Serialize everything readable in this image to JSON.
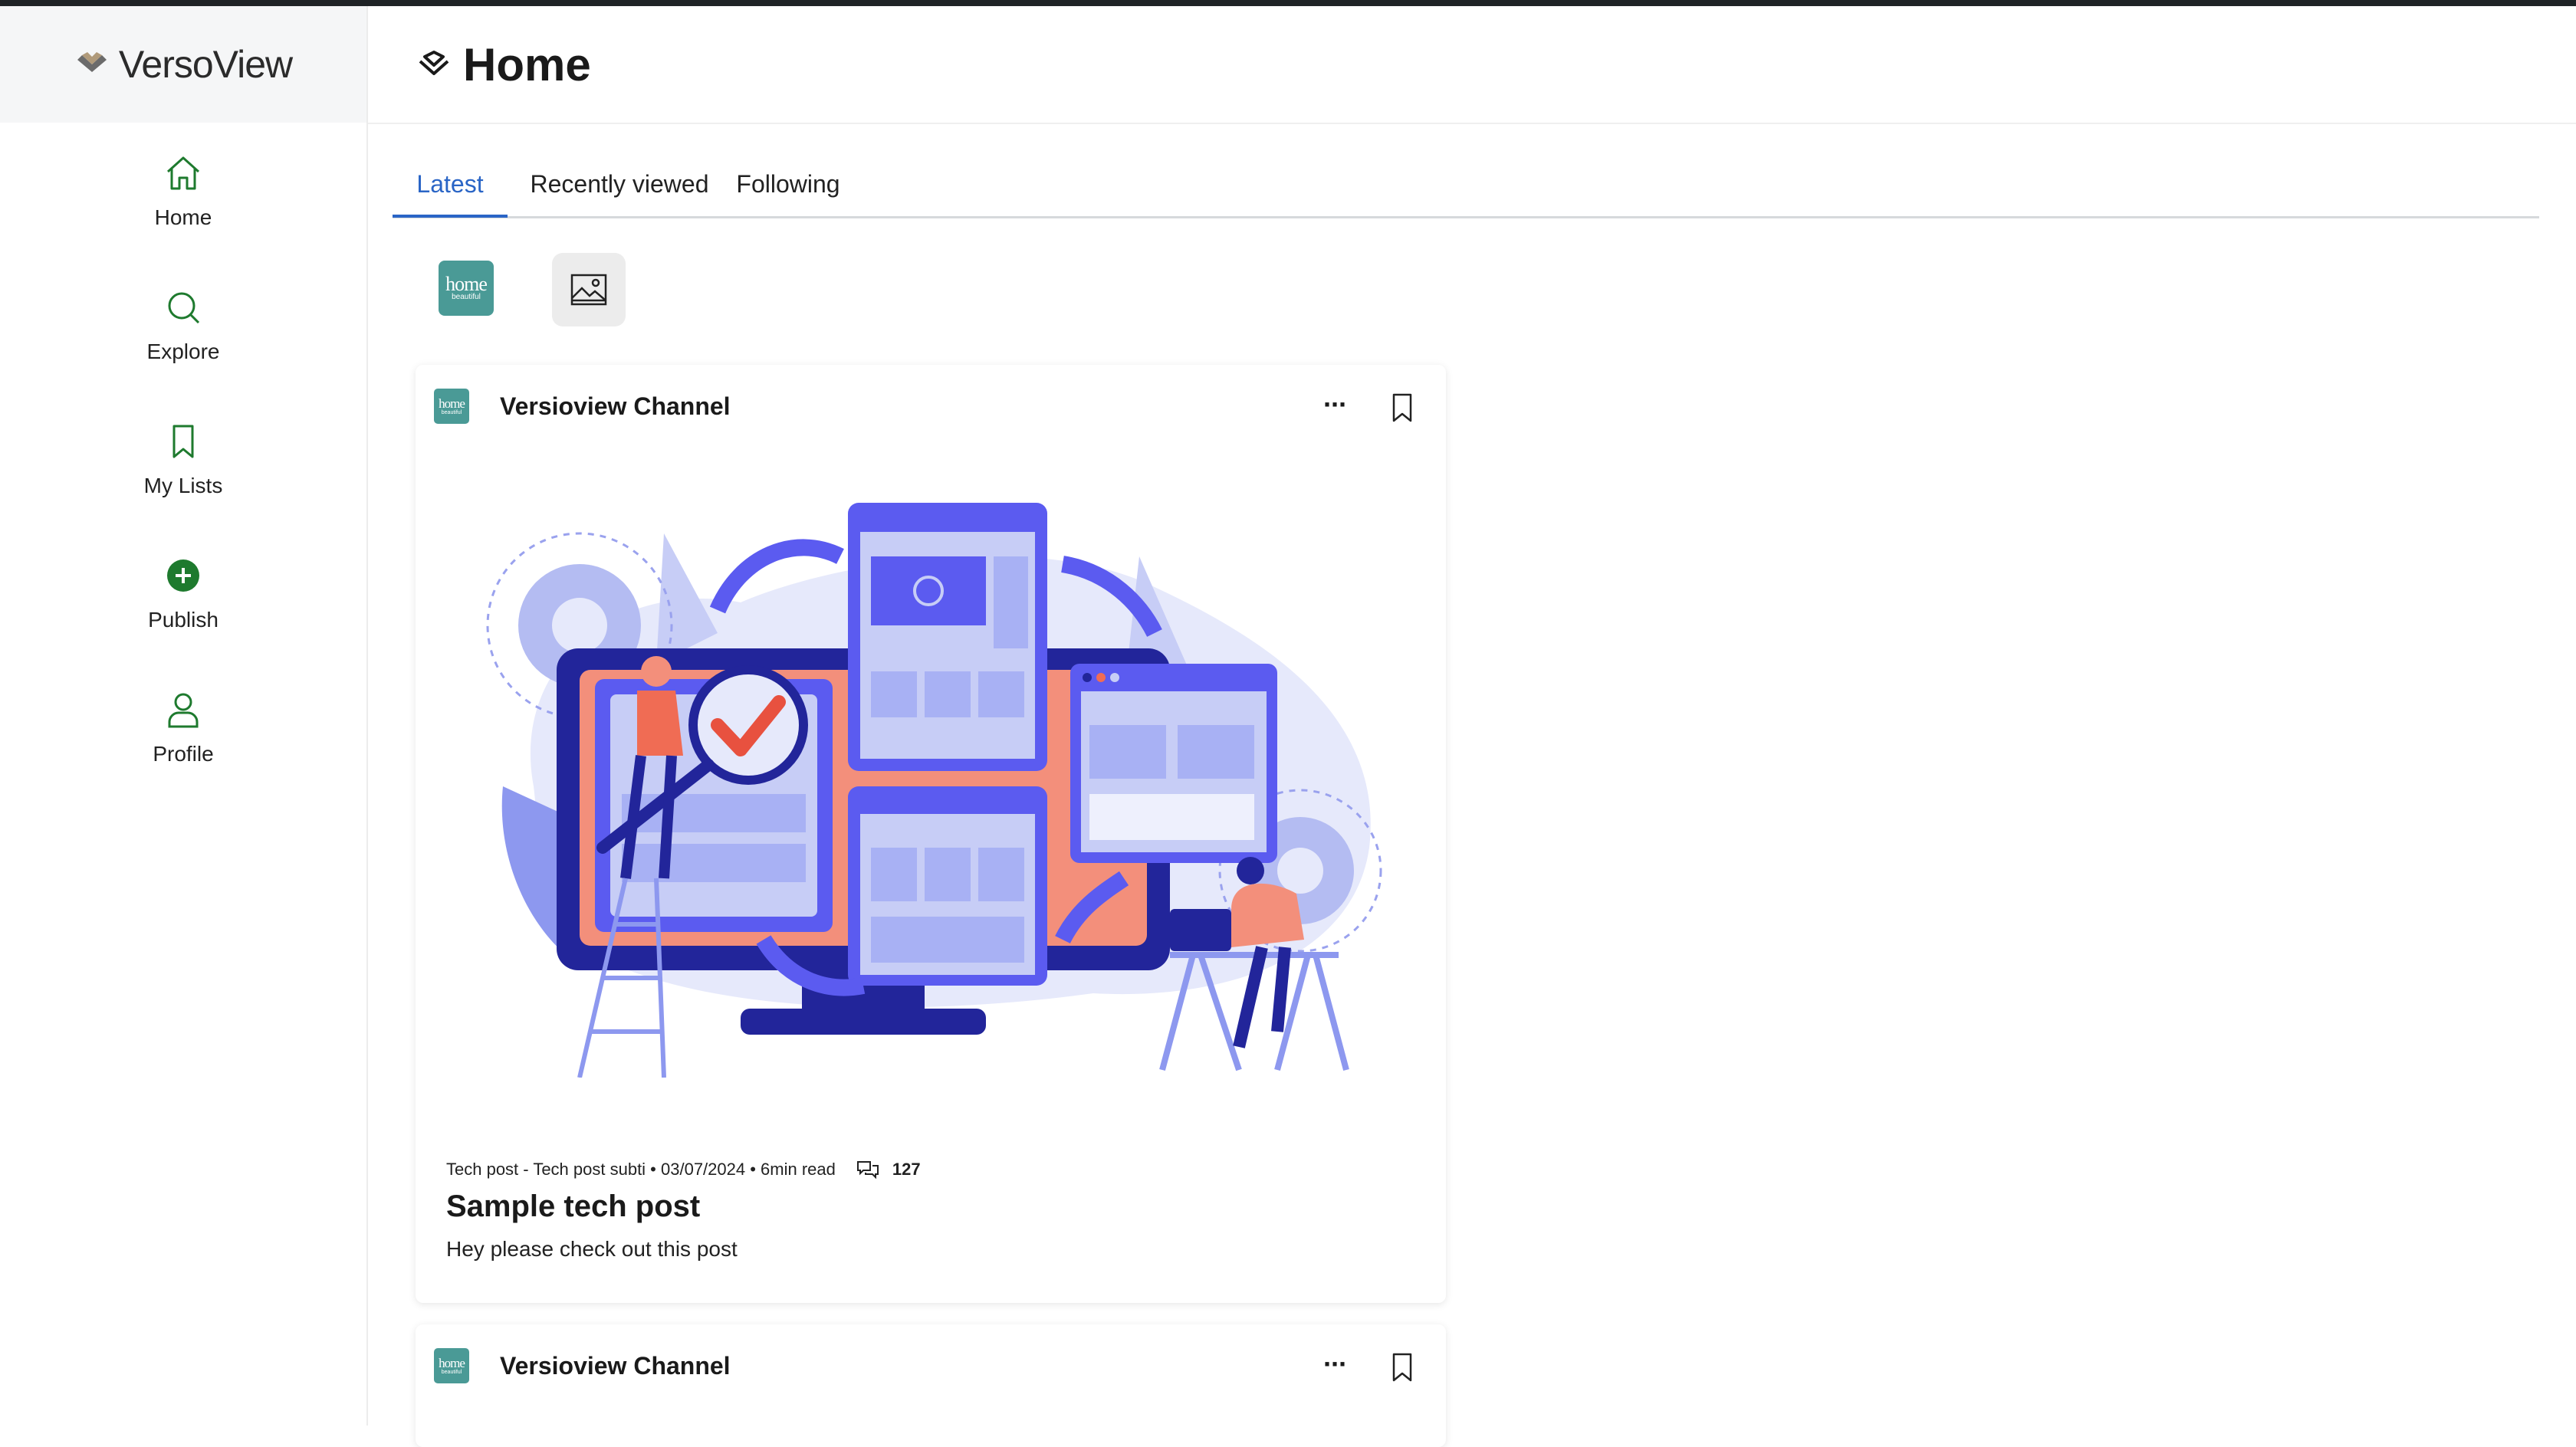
{
  "app": {
    "brand": "VersoView"
  },
  "sidebar": {
    "items": [
      {
        "label": "Home",
        "icon": "home-icon"
      },
      {
        "label": "Explore",
        "icon": "search-icon"
      },
      {
        "label": "My Lists",
        "icon": "bookmark-icon"
      },
      {
        "label": "Publish",
        "icon": "plus-circle-icon"
      },
      {
        "label": "Profile",
        "icon": "user-icon"
      }
    ]
  },
  "header": {
    "title": "Home"
  },
  "tabs": [
    {
      "label": "Latest",
      "active": true
    },
    {
      "label": "Recently viewed",
      "active": false
    },
    {
      "label": "Following",
      "active": false
    }
  ],
  "channels": [
    {
      "logo_big": "home",
      "logo_small": "beautiful"
    },
    {
      "icon": "image-placeholder-icon"
    }
  ],
  "posts": [
    {
      "channel": "Versioview Channel",
      "logo_big": "home",
      "logo_small": "beautiful",
      "meta": "Tech post - Tech post subti • 03/07/2024 • 6min read",
      "comments": "127",
      "title": "Sample tech post",
      "description": "Hey please check out this post",
      "more": "···"
    },
    {
      "channel": "Versioview Channel",
      "logo_big": "home",
      "logo_small": "beautiful",
      "more": "···"
    }
  ],
  "colors": {
    "accent": "#2a65c6",
    "brand_green": "#1e7a2e",
    "channel_teal": "#4a9a96",
    "illustration_blue": "#5b5bf0",
    "illustration_salmon": "#f38f7b"
  }
}
